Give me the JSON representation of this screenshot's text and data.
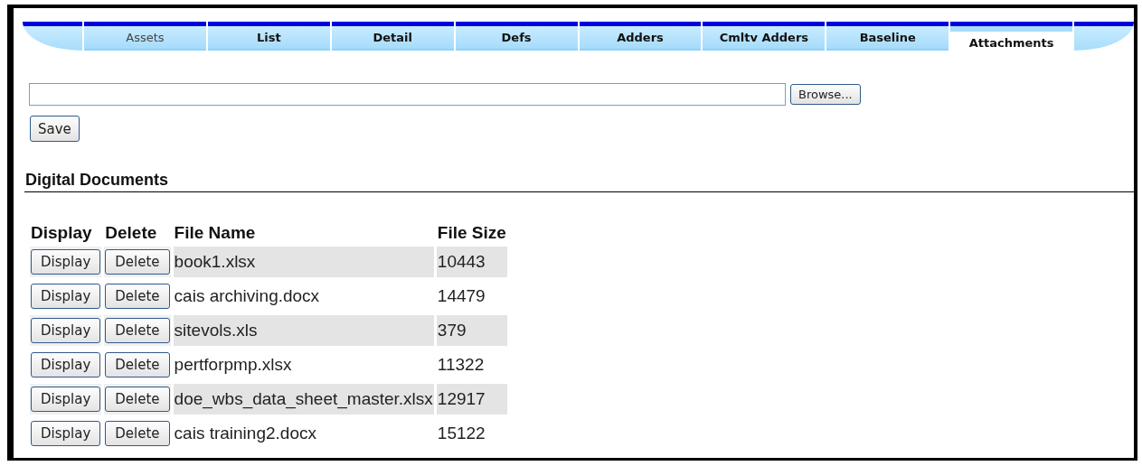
{
  "tabs": [
    {
      "label": "Assets",
      "selected": false,
      "disabled": true
    },
    {
      "label": "List",
      "selected": false,
      "disabled": false
    },
    {
      "label": "Detail",
      "selected": false,
      "disabled": false
    },
    {
      "label": "Defs",
      "selected": false,
      "disabled": false
    },
    {
      "label": "Adders",
      "selected": false,
      "disabled": false
    },
    {
      "label": "Cmltv Adders",
      "selected": false,
      "disabled": false
    },
    {
      "label": "Baseline",
      "selected": false,
      "disabled": false
    },
    {
      "label": "Attachments",
      "selected": true,
      "disabled": false
    }
  ],
  "upload": {
    "browse_button": "Browse...",
    "save_button": "Save"
  },
  "section_title": "Digital Documents",
  "table": {
    "columns": [
      "Display",
      "Delete",
      "File Name",
      "File Size"
    ],
    "rows": [
      {
        "display_button": "Display",
        "delete_button": "Delete",
        "file_name": "book1.xlsx",
        "file_size": "10443"
      },
      {
        "display_button": "Display",
        "delete_button": "Delete",
        "file_name": "cais archiving.docx",
        "file_size": "14479"
      },
      {
        "display_button": "Display",
        "delete_button": "Delete",
        "file_name": "sitevols.xls",
        "file_size": "379"
      },
      {
        "display_button": "Display",
        "delete_button": "Delete",
        "file_name": "pertforpmp.xlsx",
        "file_size": "11322"
      },
      {
        "display_button": "Display",
        "delete_button": "Delete",
        "file_name": "doe_wbs_data_sheet_master.xlsx",
        "file_size": "12917"
      },
      {
        "display_button": "Display",
        "delete_button": "Delete",
        "file_name": "cais training2.docx",
        "file_size": "15122"
      }
    ]
  }
}
